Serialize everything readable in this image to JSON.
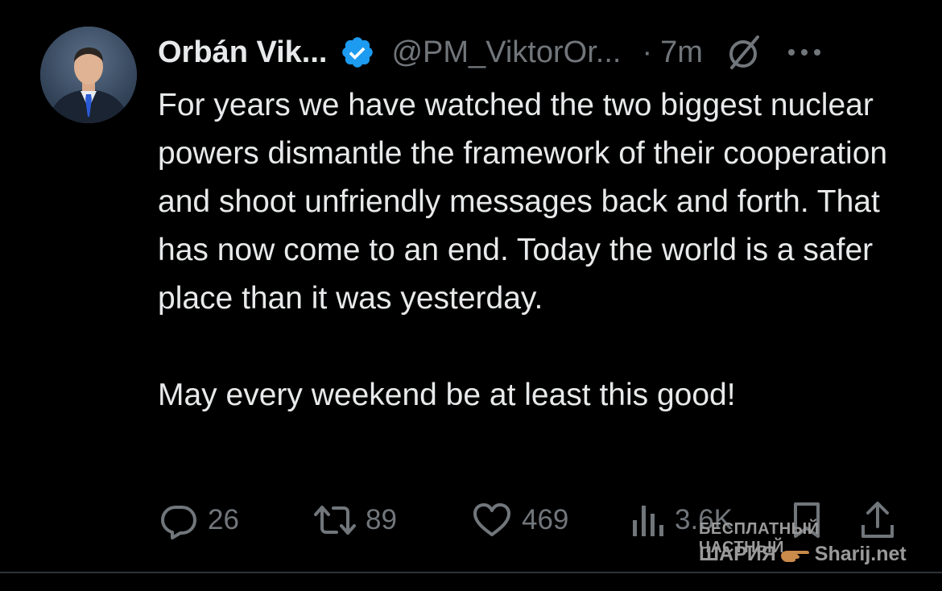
{
  "tweet": {
    "author_name": "Orbán Vik...",
    "handle": "@PM_ViktorOr...",
    "separator": "·",
    "time": "7m",
    "paragraphs": [
      "For years we have watched the two biggest nuclear powers dismantle the framework of their cooperation and shoot unfriendly messages back and forth. That has now come to an end. Today the world is a safer place than it was yesterday.",
      "May every weekend be at least this good!"
    ]
  },
  "actions": {
    "replies": "26",
    "reposts": "89",
    "likes": "469",
    "views": "3.6K"
  },
  "watermark": {
    "line1": "БЕСПЛАТНЫЙ ЧАСТНЫЙ",
    "brand": "ШАРИЯ",
    "site": "Sharij.net"
  },
  "colors": {
    "background": "#000000",
    "text": "#e7e9ea",
    "secondary": "#71767b",
    "verified_badge": "#1d9bf0",
    "divider": "#2f3336"
  },
  "icons": {
    "verified": "verified-badge-icon",
    "grok": "grok-icon",
    "more": "more-options-icon",
    "reply": "reply-icon",
    "repost": "repost-icon",
    "like": "like-icon",
    "views": "views-icon",
    "bookmark": "bookmark-icon",
    "share": "share-icon"
  }
}
